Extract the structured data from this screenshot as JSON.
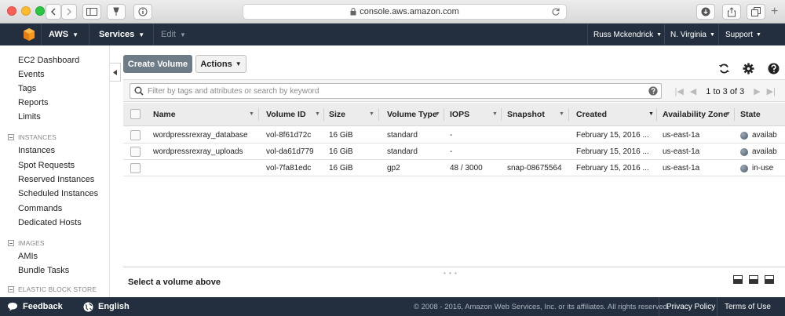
{
  "browser": {
    "url": "console.aws.amazon.com"
  },
  "nav": {
    "brand": "AWS",
    "services": "Services",
    "edit": "Edit",
    "user": "Russ Mckendrick",
    "region": "N. Virginia",
    "support": "Support"
  },
  "sidebar": {
    "links_top": [
      "EC2 Dashboard",
      "Events",
      "Tags",
      "Reports",
      "Limits"
    ],
    "sections": [
      {
        "title": "INSTANCES",
        "items": [
          "Instances",
          "Spot Requests",
          "Reserved Instances",
          "Scheduled Instances",
          "Commands",
          "Dedicated Hosts"
        ]
      },
      {
        "title": "IMAGES",
        "items": [
          "AMIs",
          "Bundle Tasks"
        ]
      },
      {
        "title": "ELASTIC BLOCK STORE",
        "items": []
      }
    ]
  },
  "toolbar": {
    "create": "Create Volume",
    "actions": "Actions"
  },
  "filter": {
    "placeholder": "Filter by tags and attributes or search by keyword",
    "pager": "1 to 3 of 3"
  },
  "table": {
    "columns": [
      "Name",
      "Volume ID",
      "Size",
      "Volume Type",
      "IOPS",
      "Snapshot",
      "Created",
      "Availability Zone",
      "State"
    ],
    "rows": [
      [
        "wordpressrexray_database",
        "vol-8f61d72c",
        "16 GiB",
        "standard",
        "-",
        "",
        "February 15, 2016 ...",
        "us-east-1a",
        "availab"
      ],
      [
        "wordpressrexray_uploads",
        "vol-da61d779",
        "16 GiB",
        "standard",
        "-",
        "",
        "February 15, 2016 ...",
        "us-east-1a",
        "availab"
      ],
      [
        "",
        "vol-7fa81edc",
        "16 GiB",
        "gp2",
        "48 / 3000",
        "snap-08675564",
        "February 15, 2016 ...",
        "us-east-1a",
        "in-use"
      ]
    ]
  },
  "detail": {
    "title": "Select a volume above"
  },
  "footer": {
    "feedback": "Feedback",
    "language": "English",
    "copyright": "© 2008 - 2016, Amazon Web Services, Inc. or its affiliates. All rights reserved.",
    "privacy": "Privacy Policy",
    "terms": "Terms of Use"
  },
  "colors": {
    "nav_bg": "#232f3e",
    "primary_button": "#6e7c87"
  }
}
